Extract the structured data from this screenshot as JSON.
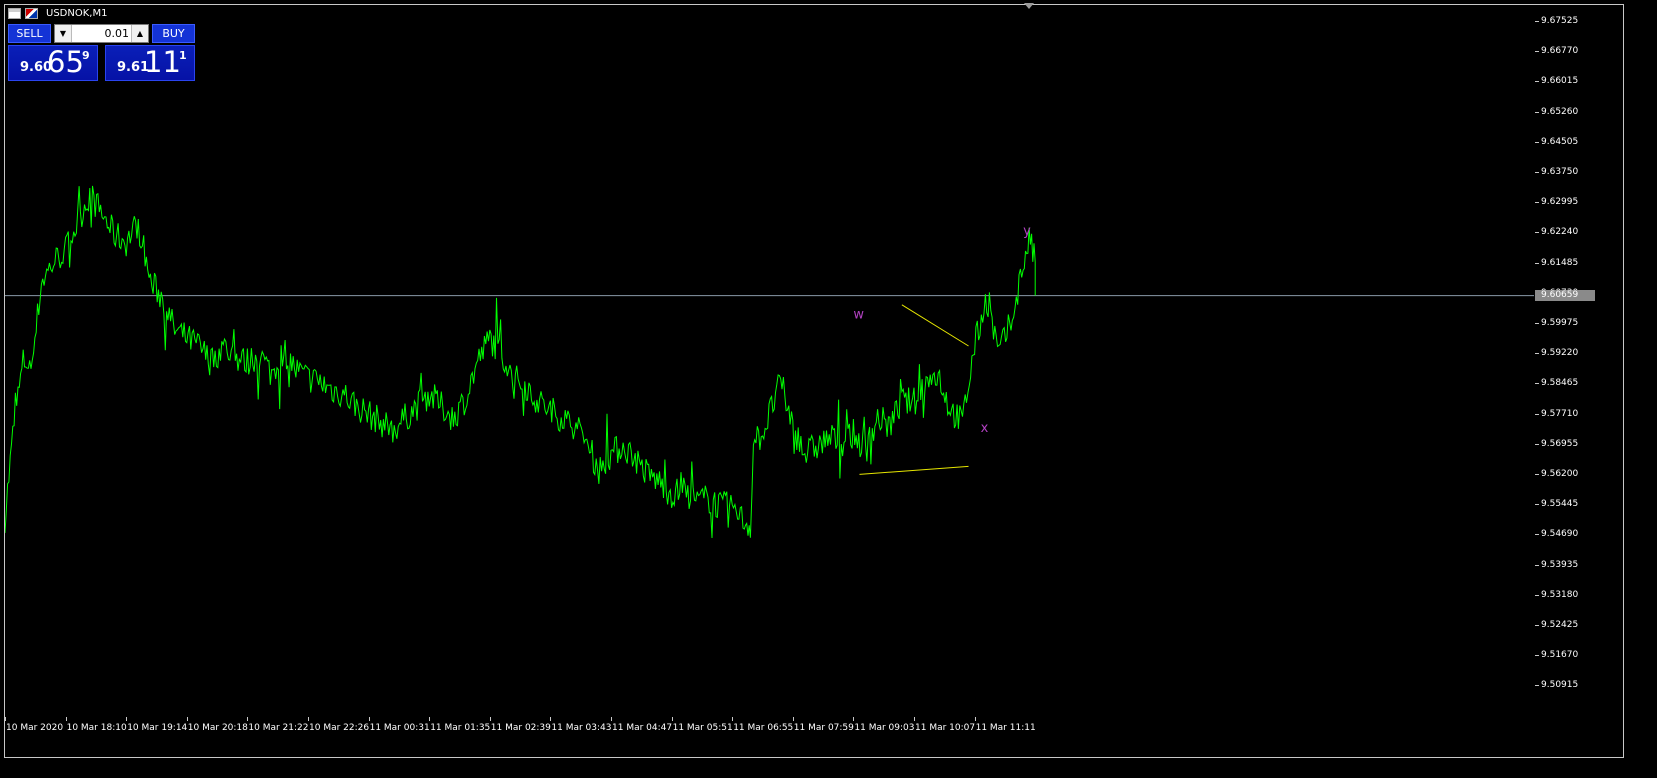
{
  "window": {
    "title": "USDNOK,M1",
    "icons": [
      "window-menu-icon",
      "flag-icon"
    ]
  },
  "trade_panel": {
    "sell_label": "SELL",
    "buy_label": "BUY",
    "lot_value": "0.01",
    "sell_price": {
      "small": "9.60",
      "big": "65",
      "sup": "9"
    },
    "buy_price": {
      "small": "9.61",
      "big": "11",
      "sup": "1"
    },
    "colors": {
      "panel": "#1433d6",
      "price_box": "#0a1fb8"
    }
  },
  "current_price": "9.60659",
  "price_axis": [
    "9.67525",
    "9.66770",
    "9.66015",
    "9.65260",
    "9.64505",
    "9.63750",
    "9.62995",
    "9.62240",
    "9.61485",
    "9.60730",
    "9.59975",
    "9.59220",
    "9.58465",
    "9.57710",
    "9.56955",
    "9.56200",
    "9.55445",
    "9.54690",
    "9.53935",
    "9.53180",
    "9.52425",
    "9.51670",
    "9.50915"
  ],
  "time_axis": [
    "10 Mar 2020",
    "10 Mar 18:10",
    "10 Mar 19:14",
    "10 Mar 20:18",
    "10 Mar 21:22",
    "10 Mar 22:26",
    "11 Mar 00:31",
    "11 Mar 01:35",
    "11 Mar 02:39",
    "11 Mar 03:43",
    "11 Mar 04:47",
    "11 Mar 05:51",
    "11 Mar 06:55",
    "11 Mar 07:59",
    "11 Mar 09:03",
    "11 Mar 10:07",
    "11 Mar 11:11"
  ],
  "annotations": [
    {
      "text": "w",
      "color": "#b040c0"
    },
    {
      "text": "x",
      "color": "#b040c0"
    },
    {
      "text": "y",
      "color": "#b040c0"
    }
  ],
  "chart_data": {
    "type": "line",
    "symbol": "USDNOK",
    "timeframe": "M1",
    "series_color": "#00ff00",
    "grid": false,
    "ylim": [
      9.5054,
      9.679
    ],
    "x": [
      "10 Mar 2020",
      "10 Mar 18:10",
      "10 Mar 19:14",
      "10 Mar 20:18",
      "10 Mar 21:22",
      "10 Mar 22:26",
      "11 Mar 00:31",
      "11 Mar 01:35",
      "11 Mar 02:39",
      "11 Mar 03:43",
      "11 Mar 04:47",
      "11 Mar 05:51",
      "11 Mar 06:55",
      "11 Mar 07:59",
      "11 Mar 09:03",
      "11 Mar 10:07",
      "11 Mar 11:11"
    ],
    "points": [
      [
        0,
        9.551
      ],
      [
        0.15,
        9.575
      ],
      [
        0.3,
        9.59
      ],
      [
        0.45,
        9.59
      ],
      [
        0.6,
        9.61
      ],
      [
        0.8,
        9.615
      ],
      [
        1.0,
        9.618
      ],
      [
        1.2,
        9.625
      ],
      [
        1.4,
        9.632
      ],
      [
        1.6,
        9.627
      ],
      [
        1.8,
        9.622
      ],
      [
        2.0,
        9.62
      ],
      [
        2.2,
        9.625
      ],
      [
        2.4,
        9.61
      ],
      [
        2.6,
        9.606
      ],
      [
        2.8,
        9.598
      ],
      [
        3.0,
        9.596
      ],
      [
        3.2,
        9.594
      ],
      [
        3.4,
        9.59
      ],
      [
        3.6,
        9.594
      ],
      [
        3.8,
        9.591
      ],
      [
        4.0,
        9.59
      ],
      [
        4.2,
        9.592
      ],
      [
        4.4,
        9.587
      ],
      [
        4.6,
        9.593
      ],
      [
        4.8,
        9.588
      ],
      [
        5.0,
        9.586
      ],
      [
        5.2,
        9.585
      ],
      [
        5.4,
        9.583
      ],
      [
        5.6,
        9.582
      ],
      [
        5.8,
        9.579
      ],
      [
        6.0,
        9.577
      ],
      [
        6.2,
        9.575
      ],
      [
        6.4,
        9.573
      ],
      [
        6.6,
        9.576
      ],
      [
        6.8,
        9.579
      ],
      [
        7.0,
        9.582
      ],
      [
        7.2,
        9.579
      ],
      [
        7.4,
        9.576
      ],
      [
        7.6,
        9.581
      ],
      [
        7.8,
        9.59
      ],
      [
        8.0,
        9.596
      ],
      [
        8.2,
        9.592
      ],
      [
        8.4,
        9.586
      ],
      [
        8.6,
        9.584
      ],
      [
        8.8,
        9.58
      ],
      [
        9.0,
        9.578
      ],
      [
        9.2,
        9.576
      ],
      [
        9.4,
        9.574
      ],
      [
        9.6,
        9.57
      ],
      [
        9.8,
        9.563
      ],
      [
        10.0,
        9.567
      ],
      [
        10.2,
        9.569
      ],
      [
        10.4,
        9.566
      ],
      [
        10.6,
        9.562
      ],
      [
        10.8,
        9.56
      ],
      [
        11.0,
        9.557
      ],
      [
        11.2,
        9.558
      ],
      [
        11.4,
        9.555
      ],
      [
        11.6,
        9.556
      ],
      [
        11.8,
        9.554
      ],
      [
        12.0,
        9.554
      ],
      [
        12.2,
        9.55
      ],
      [
        12.3,
        9.549
      ],
      [
        12.35,
        9.57
      ],
      [
        12.5,
        9.572
      ],
      [
        12.8,
        9.585
      ],
      [
        13.0,
        9.574
      ],
      [
        13.2,
        9.567
      ],
      [
        13.4,
        9.569
      ],
      [
        13.6,
        9.571
      ],
      [
        13.8,
        9.57
      ],
      [
        14.0,
        9.572
      ],
      [
        14.2,
        9.568
      ],
      [
        14.4,
        9.576
      ],
      [
        14.6,
        9.574
      ],
      [
        14.8,
        9.58
      ],
      [
        15.0,
        9.58
      ],
      [
        15.2,
        9.585
      ],
      [
        15.4,
        9.587
      ],
      [
        15.6,
        9.578
      ],
      [
        15.8,
        9.575
      ],
      [
        16.0,
        9.594
      ],
      [
        16.2,
        9.606
      ],
      [
        16.4,
        9.592
      ],
      [
        16.6,
        9.6
      ],
      [
        16.8,
        9.614
      ],
      [
        16.9,
        9.621
      ],
      [
        17.0,
        9.615
      ]
    ]
  }
}
